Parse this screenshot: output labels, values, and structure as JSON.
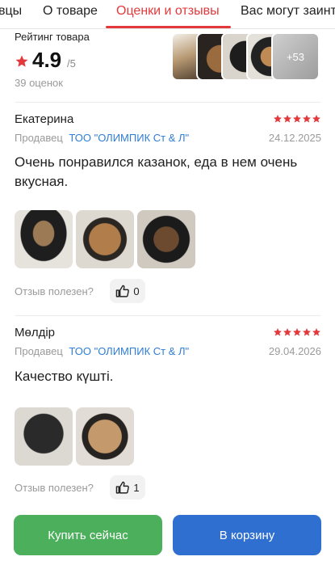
{
  "tabs": [
    {
      "label": "вцы",
      "active": false
    },
    {
      "label": "О товаре",
      "active": false
    },
    {
      "label": "Оценки и отзывы",
      "active": true
    },
    {
      "label": "Вас могут заинт",
      "active": false
    }
  ],
  "rating": {
    "title": "Рейтинг товара",
    "value": "4.9",
    "max": "/5",
    "count": "39 оценок",
    "more_photos": "+53"
  },
  "reviews": [
    {
      "author": "Екатерина",
      "stars": 5,
      "seller_label": "Продавец",
      "seller_name": "ТОО \"ОЛИМПИК Ст & Л\"",
      "date": "24.12.2025",
      "text": "Очень понравился казанок, еда в нем очень вкусная.",
      "photos": 3,
      "helpful_label": "Отзыв полезен?",
      "helpful_count": "0"
    },
    {
      "author": "Мөлдір",
      "stars": 5,
      "seller_label": "Продавец",
      "seller_name": "ТОО \"ОЛИМПИК Ст & Л\"",
      "date": "29.04.2026",
      "text": "Качество күшті.",
      "photos": 2,
      "helpful_label": "Отзыв полезен?",
      "helpful_count": "1"
    }
  ],
  "actions": {
    "buy_now": "Купить сейчас",
    "add_to_cart": "В корзину"
  },
  "colors": {
    "accent_red": "#e4393c",
    "seller_link": "#2e7dd7",
    "buy_green": "#4caf5c",
    "cart_blue": "#2e6fd0"
  },
  "icons": [
    "star-icon",
    "thumbs-up-icon"
  ]
}
